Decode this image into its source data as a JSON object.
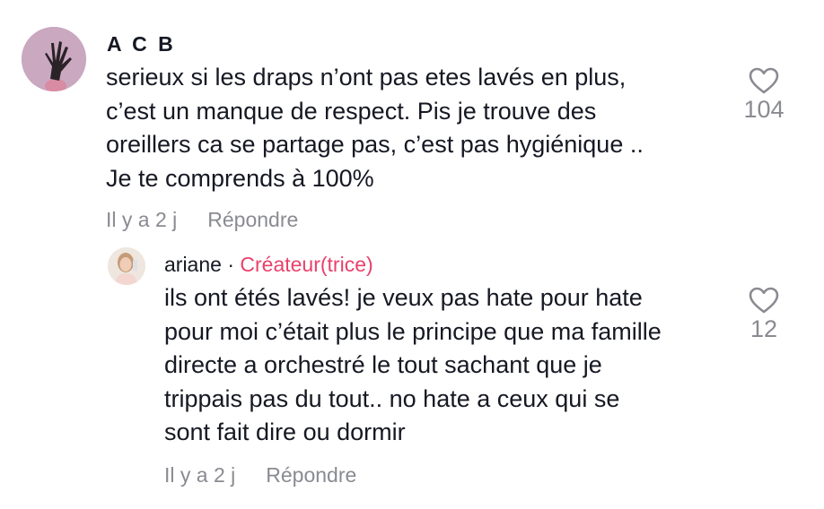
{
  "comments": [
    {
      "username": "A C B",
      "avatar_icon": "hand-claws-avatar",
      "text": "serieux si les draps n’ont pas etes lavés en plus,\nc’est un manque de respect. Pis je trouve des\noreillers ca se partage pas, c’est pas hygiénique ..\nJe te comprends à 100%",
      "time": "Il y a 2 j",
      "reply_label": "Répondre",
      "likes": "104"
    },
    {
      "username": "ariane",
      "separator": "·",
      "badge": "Créateur(trice)",
      "avatar_icon": "woman-selfie-avatar",
      "text": "ils ont étés lavés! je veux pas hate pour hate\npour moi c’était plus le principe que ma famille\ndirecte a orchestré le tout sachant que je\ntrippais pas du tout.. no hate a ceux qui se\nsont fait dire ou dormir",
      "time": "Il y a 2 j",
      "reply_label": "Répondre",
      "likes": "12"
    }
  ],
  "colors": {
    "creator_badge": "#e9416b",
    "meta_text": "#8a8b91",
    "primary_text": "#161823"
  }
}
